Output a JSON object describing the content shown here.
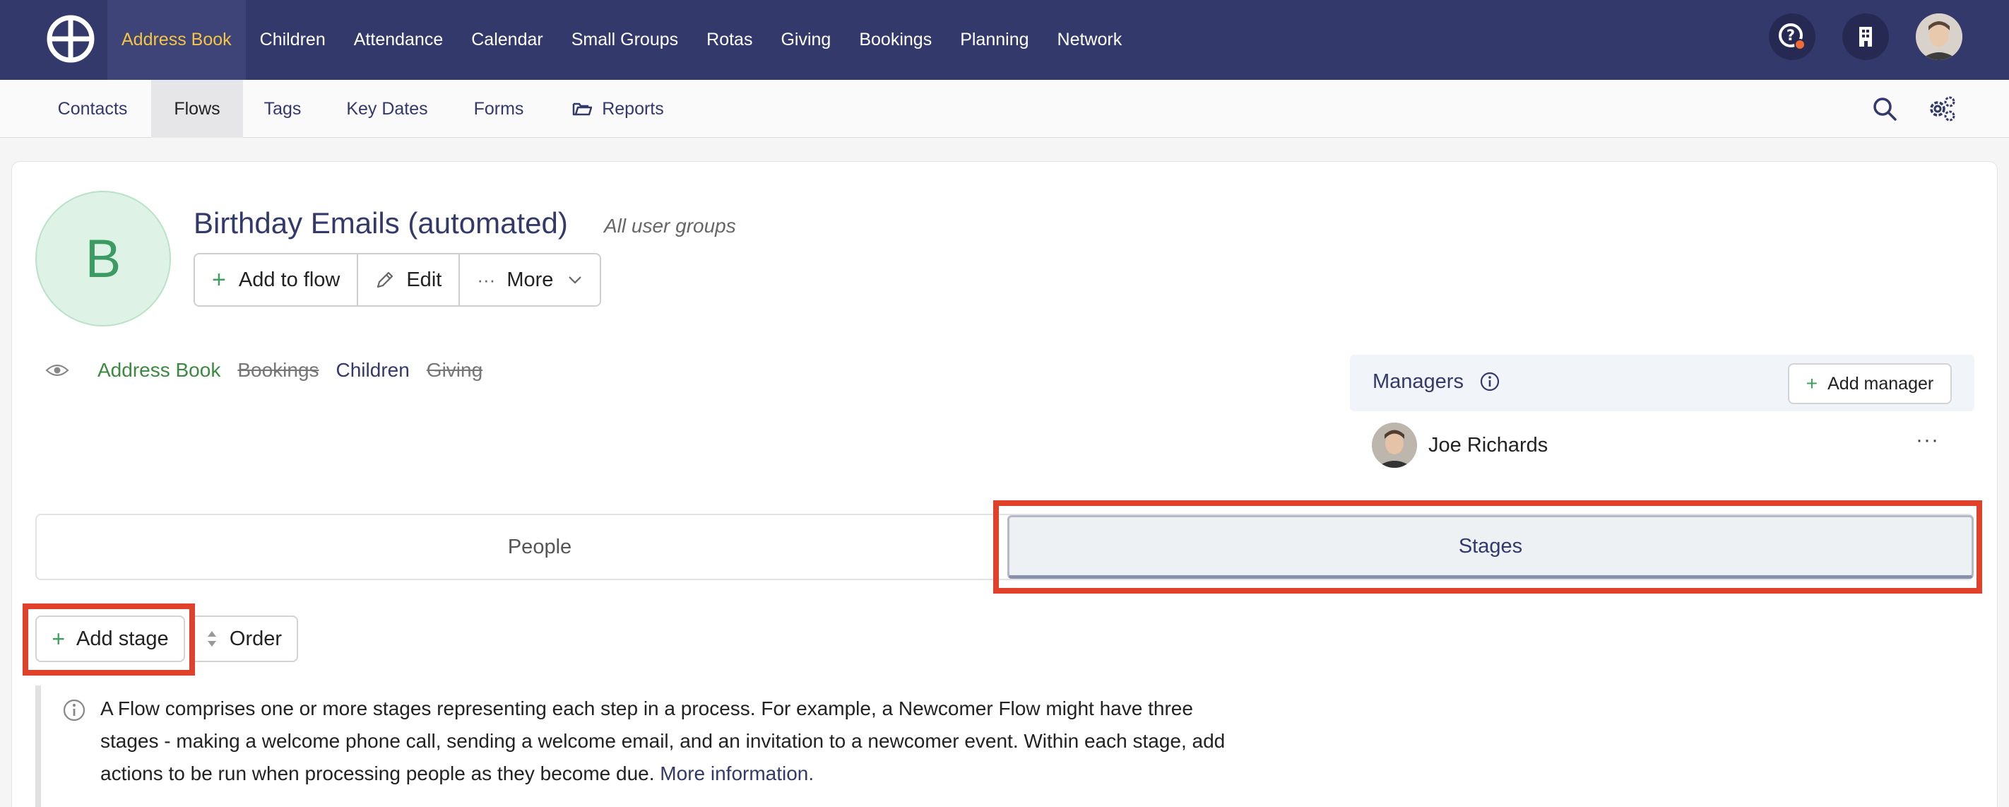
{
  "topnav": {
    "logo_icon": "crosshair-logo-icon",
    "items": [
      {
        "label": "Address Book",
        "active": true
      },
      {
        "label": "Children"
      },
      {
        "label": "Attendance"
      },
      {
        "label": "Calendar"
      },
      {
        "label": "Small Groups"
      },
      {
        "label": "Rotas"
      },
      {
        "label": "Giving"
      },
      {
        "label": "Bookings"
      },
      {
        "label": "Planning"
      },
      {
        "label": "Network"
      }
    ],
    "right_icons": [
      "help-icon",
      "building-icon",
      "user-avatar"
    ],
    "accent_color": "#f4c544",
    "bg_color": "#33396b"
  },
  "subnav": {
    "items": [
      {
        "label": "Contacts"
      },
      {
        "label": "Flows",
        "active": true
      },
      {
        "label": "Tags"
      },
      {
        "label": "Key Dates"
      },
      {
        "label": "Forms"
      },
      {
        "label": "Reports",
        "icon": "folder-icon"
      }
    ],
    "right_icons": [
      "search-icon",
      "settings-icon"
    ]
  },
  "flow": {
    "avatar_letter": "B",
    "title": "Birthday Emails (automated)",
    "subtitle": "All user groups",
    "actions": {
      "add_to_flow": "Add to flow",
      "edit": "Edit",
      "more": "More"
    },
    "access": [
      {
        "label": "Address Book",
        "state": "enabled"
      },
      {
        "label": "Bookings",
        "state": "disabled"
      },
      {
        "label": "Children",
        "state": "enabled-blue"
      },
      {
        "label": "Giving",
        "state": "disabled"
      }
    ]
  },
  "managers": {
    "title": "Managers",
    "add_label": "Add manager",
    "list": [
      {
        "name": "Joe Richards",
        "menu": "···"
      }
    ]
  },
  "tabs": {
    "people": "People",
    "stages": "Stages",
    "active": "stages"
  },
  "stage_actions": {
    "add_stage": "Add stage",
    "order": "Order"
  },
  "info": {
    "text": "A Flow comprises one or more stages representing each step in a process. For example, a Newcomer Flow might have three stages - making a welcome phone call, sending a welcome email, and an invitation to a newcomer event. Within each stage, add actions to be run when processing people as they become due. ",
    "link": "More information."
  },
  "highlight_color": "#e0412a"
}
